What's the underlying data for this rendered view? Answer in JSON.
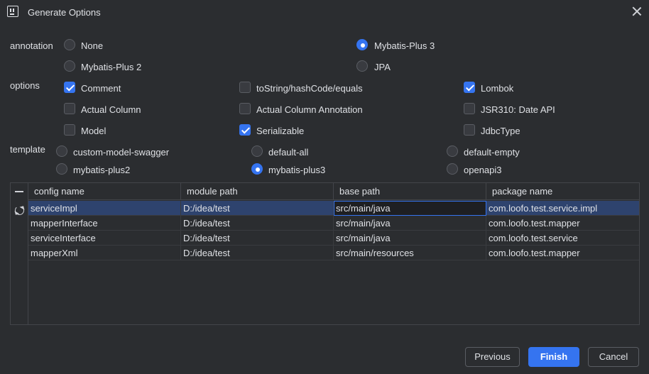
{
  "window": {
    "title": "Generate Options"
  },
  "annotation": {
    "label": "annotation",
    "options": [
      {
        "label": "None",
        "selected": false
      },
      {
        "label": "Mybatis-Plus 3",
        "selected": true
      },
      {
        "label": "Mybatis-Plus 2",
        "selected": false
      },
      {
        "label": "JPA",
        "selected": false
      }
    ]
  },
  "options": {
    "label": "options",
    "items": [
      {
        "label": "Comment",
        "checked": true
      },
      {
        "label": "toString/hashCode/equals",
        "checked": false
      },
      {
        "label": "Lombok",
        "checked": true
      },
      {
        "label": "Actual Column",
        "checked": false
      },
      {
        "label": "Actual Column Annotation",
        "checked": false
      },
      {
        "label": "JSR310: Date API",
        "checked": false
      },
      {
        "label": "Model",
        "checked": false
      },
      {
        "label": "Serializable",
        "checked": true
      },
      {
        "label": "JdbcType",
        "checked": false
      }
    ]
  },
  "template": {
    "label": "template",
    "options": [
      {
        "label": "custom-model-swagger",
        "selected": false
      },
      {
        "label": "default-all",
        "selected": false
      },
      {
        "label": "default-empty",
        "selected": false
      },
      {
        "label": "mybatis-plus2",
        "selected": false
      },
      {
        "label": "mybatis-plus3",
        "selected": true
      },
      {
        "label": "openapi3",
        "selected": false
      }
    ]
  },
  "table": {
    "columns": [
      "config name",
      "module path",
      "base path",
      "package name"
    ],
    "rows": [
      [
        "serviceImpl",
        "D:/idea/test",
        "src/main/java",
        "com.loofo.test.service.impl"
      ],
      [
        "mapperInterface",
        "D:/idea/test",
        "src/main/java",
        "com.loofo.test.mapper"
      ],
      [
        "serviceInterface",
        "D:/idea/test",
        "src/main/java",
        "com.loofo.test.service"
      ],
      [
        "mapperXml",
        "D:/idea/test",
        "src/main/resources",
        "com.loofo.test.mapper"
      ]
    ],
    "selected_row": 0
  },
  "buttons": {
    "previous": "Previous",
    "finish": "Finish",
    "cancel": "Cancel"
  },
  "colors": {
    "accent": "#3574f0",
    "background": "#2b2d30",
    "selection": "#2e436e"
  },
  "icons": {
    "app": "intellij-app-icon",
    "close": "close-icon",
    "remove": "minus-icon",
    "refresh": "refresh-icon"
  }
}
